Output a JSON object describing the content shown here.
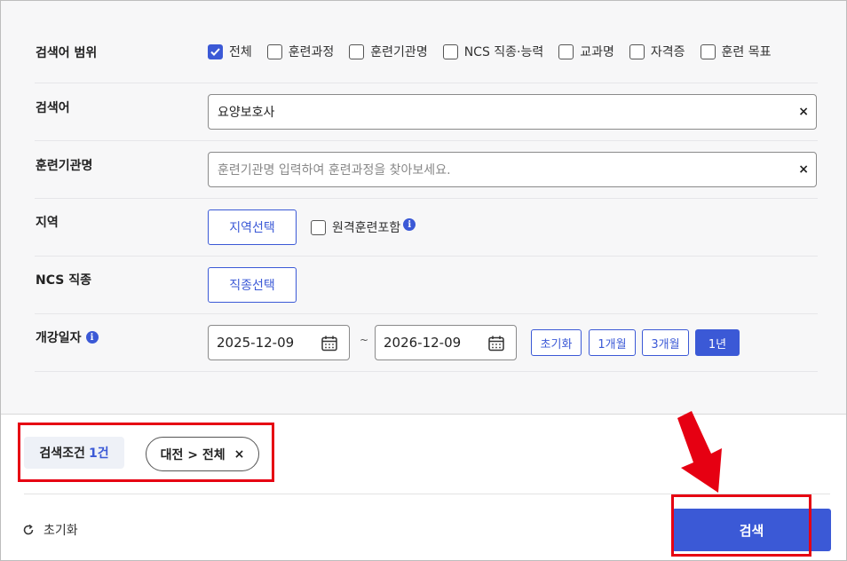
{
  "scope": {
    "label": "검색어 범위",
    "options": [
      {
        "label": "전체",
        "checked": true
      },
      {
        "label": "훈련과정",
        "checked": false
      },
      {
        "label": "훈련기관명",
        "checked": false
      },
      {
        "label": "NCS 직종·능력",
        "checked": false
      },
      {
        "label": "교과명",
        "checked": false
      },
      {
        "label": "자격증",
        "checked": false
      },
      {
        "label": "훈련 목표",
        "checked": false
      }
    ]
  },
  "keyword": {
    "label": "검색어",
    "value": "요양보호사",
    "clear": "×"
  },
  "institution": {
    "label": "훈련기관명",
    "placeholder": "훈련기관명 입력하여 훈련과정을 찾아보세요.",
    "clear": "×"
  },
  "region": {
    "label": "지역",
    "button": "지역선택",
    "remote_label": "원격훈련포함",
    "info": "i"
  },
  "ncs": {
    "label": "NCS 직종",
    "button": "직종선택"
  },
  "opening": {
    "label": "개강일자",
    "info": "i",
    "start": "2025-12-09",
    "end": "2026-12-09",
    "tilde": "~",
    "buttons": [
      {
        "label": "초기화",
        "active": false
      },
      {
        "label": "1개월",
        "active": false
      },
      {
        "label": "3개월",
        "active": false
      },
      {
        "label": "1년",
        "active": true
      }
    ]
  },
  "conditions": {
    "label": "검색조건",
    "count": "1건",
    "chip": "대전 > 전체",
    "chip_remove": "×"
  },
  "footer": {
    "reset": "초기화",
    "search": "검색"
  },
  "colors": {
    "accent": "#3b59d6",
    "highlight": "#e60012"
  }
}
